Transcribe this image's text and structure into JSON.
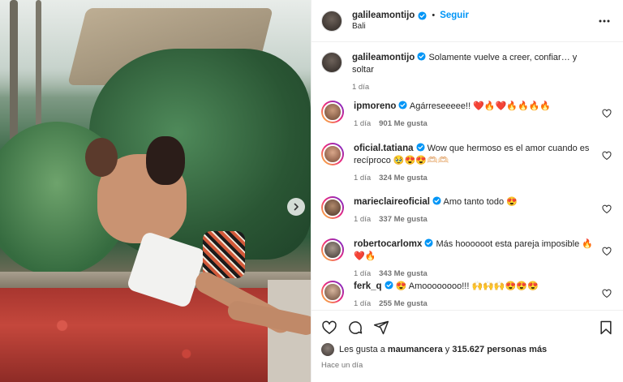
{
  "post": {
    "author": "galileamontijo",
    "follow_label": "Seguir",
    "location": "Bali",
    "caption": {
      "author": "galileamontijo",
      "text": "Solamente vuelve a creer, confiar… y soltar",
      "time": "1 día"
    },
    "photo_alt": "couple embracing by a pool with red petals"
  },
  "comments": [
    {
      "user": "ipmoreno",
      "verified": true,
      "text": "Agárreseeeee!! ❤️🔥❤️🔥🔥🔥🔥",
      "time": "1 día",
      "likes": "901 Me gusta"
    },
    {
      "user": "oficial.tatiana",
      "verified": true,
      "text": "Wow que hermoso es el amor cuando es recíproco 🥹😍😍🫶🏻🫶🏻",
      "time": "1 día",
      "likes": "324 Me gusta"
    },
    {
      "user": "marieclaireoficial",
      "verified": true,
      "text": "Amo tanto todo 😍",
      "time": "1 día",
      "likes": "337 Me gusta"
    },
    {
      "user": "robertocarlomx",
      "verified": true,
      "text": "Más hoooooot esta pareja imposible 🔥❤️🔥",
      "time": "1 día",
      "likes": "343 Me gusta"
    },
    {
      "user": "ferk_q",
      "verified": true,
      "text": "😍 Amoooooooo!!! 🙌🙌🙌😍😍😍",
      "time": "1 día",
      "likes": "255 Me gusta"
    }
  ],
  "footer": {
    "liked_prefix": "Les gusta a ",
    "liked_user": "maumancera",
    "liked_middle": " y ",
    "liked_count": "315.627 personas más",
    "posted_ago": "Hace un día"
  },
  "colors": {
    "link": "#0095f6",
    "verified": "#0095f6",
    "muted": "#737373"
  }
}
